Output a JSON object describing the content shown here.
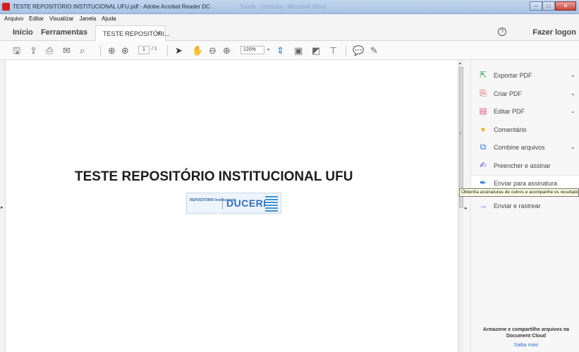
{
  "window": {
    "title": "TESTE REPOSITÓRIO INSTITUCIONAL UFU.pdf - Adobe Acrobat Reader DC",
    "ghost_title": "Tarefa - Consulta - Microsoft Word",
    "controls": {
      "minimize": "–",
      "maximize": "□",
      "close": "✕"
    }
  },
  "menu": [
    "Arquivo",
    "Editar",
    "Visualizar",
    "Janela",
    "Ajuda"
  ],
  "tabs": {
    "home": "Início",
    "tools": "Ferramentas",
    "document": "TESTE REPOSITÓRI...",
    "close": "×",
    "help": "?",
    "logout": "Fazer logon"
  },
  "toolbar": {
    "page_current": "1",
    "page_total": "/ 1",
    "zoom": "120%",
    "icons": [
      "save-icon",
      "upload-icon",
      "print-icon",
      "mail-icon",
      "search-icon",
      "prev-page-icon",
      "next-page-icon",
      "select-arrow-icon",
      "hand-icon",
      "zoom-out-icon",
      "zoom-in-icon",
      "fit-page-icon",
      "scroll-mode-icon",
      "fullscreen-icon",
      "stamp-icon",
      "comment-icon",
      "pen-icon"
    ]
  },
  "document": {
    "heading": "TESTE REPOSITÓRIO INSTITUCIONAL UFU",
    "logo_small": "REPOSITÓRIO Institucional",
    "logo_big": "DUCERE"
  },
  "tools_pane": {
    "items": [
      {
        "label": "Exportar PDF",
        "icon": "export-pdf-icon",
        "color": "#2e9b4f",
        "chevron": "⌄"
      },
      {
        "label": "Criar PDF",
        "icon": "create-pdf-icon",
        "color": "#d73a3a",
        "chevron": "⌄"
      },
      {
        "label": "Editar PDF",
        "icon": "edit-pdf-icon",
        "color": "#e05a8a",
        "chevron": "⌄"
      },
      {
        "label": "Comentário",
        "icon": "comment-icon",
        "color": "#f1b82d",
        "chevron": ""
      },
      {
        "label": "Combine arquivos",
        "icon": "combine-files-icon",
        "color": "#2d7fd4",
        "chevron": "⌄"
      },
      {
        "label": "Preencher e assinar",
        "icon": "fill-sign-icon",
        "color": "#6a5ac8",
        "chevron": ""
      },
      {
        "label": "Enviar para assinatura",
        "icon": "send-signature-icon",
        "color": "#2d6fd1",
        "chevron": ""
      },
      {
        "label": "Enviar e rastrear",
        "icon": "send-track-icon",
        "color": "#2d6fd1",
        "chevron": ""
      }
    ],
    "tooltip": "Obtenha assinaturas de outros e acompanhe os resultados",
    "cloud_text": "Armazene e compartilhe arquivos na Document Cloud",
    "cloud_link": "Saiba mais"
  }
}
